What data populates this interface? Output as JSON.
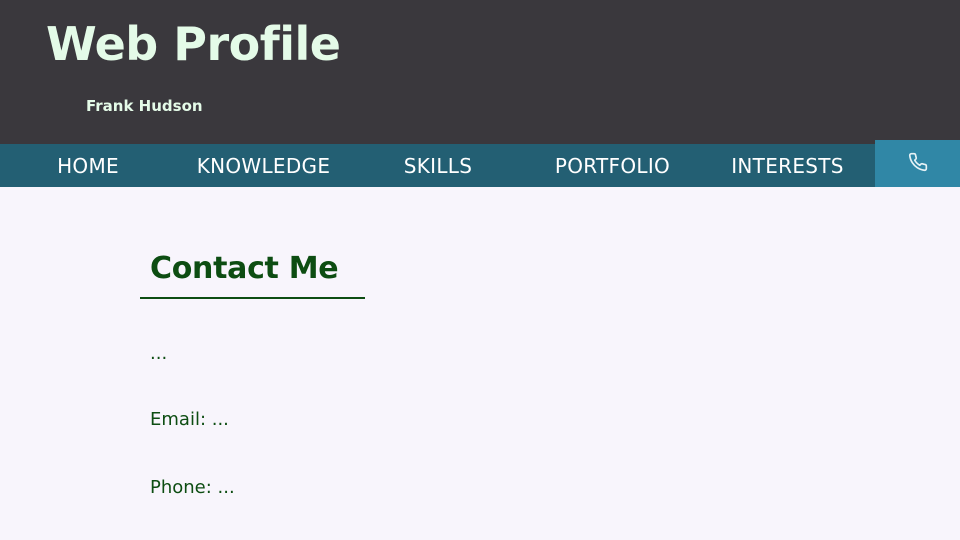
{
  "header": {
    "site_title": "Web Profile",
    "author_name": "Frank Hudson"
  },
  "nav": {
    "items": [
      {
        "label": "HOME"
      },
      {
        "label": "KNOWLEDGE"
      },
      {
        "label": "SKILLS"
      },
      {
        "label": "PORTFOLIO"
      },
      {
        "label": "INTERESTS"
      }
    ],
    "contact_icon": "phone-icon"
  },
  "contact": {
    "title": "Contact Me",
    "intro": "...",
    "email": "Email: ...",
    "phone": "Phone: ..."
  },
  "colors": {
    "header_bg": "#3a383d",
    "nav_bg": "#235f73",
    "nav_active_bg": "#3087a6",
    "title_text": "#e4fbe8",
    "content_text": "#0d4d12",
    "page_bg": "#f8f5fc"
  }
}
